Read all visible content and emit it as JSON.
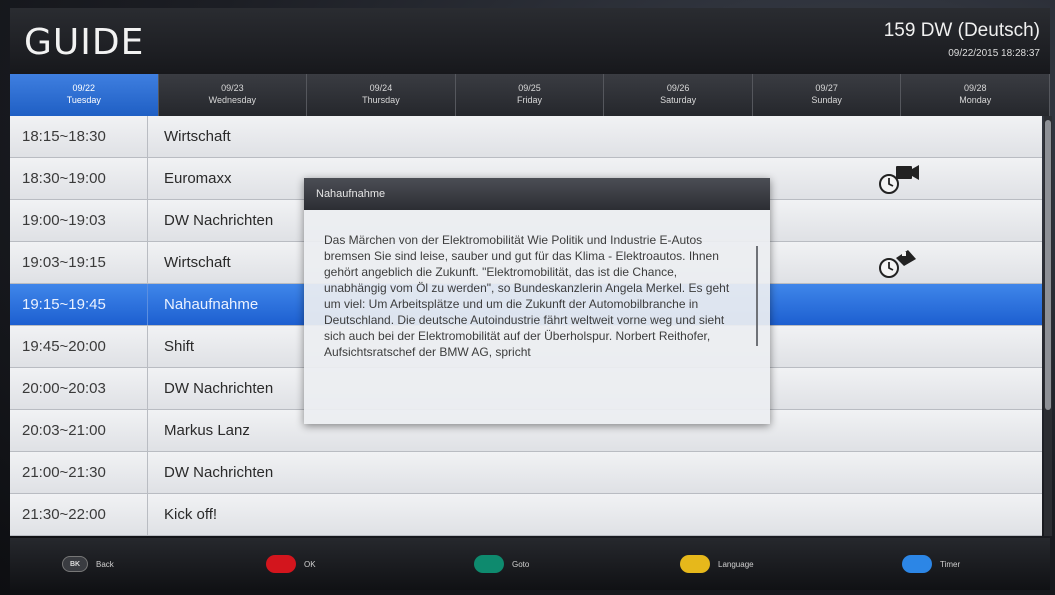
{
  "header": {
    "title": "GUIDE",
    "channel": "159 DW (Deutsch)",
    "datetime": "09/22/2015 18:28:37"
  },
  "tabs": [
    {
      "date": "09/22",
      "day": "Tuesday",
      "active": true
    },
    {
      "date": "09/23",
      "day": "Wednesday",
      "active": false
    },
    {
      "date": "09/24",
      "day": "Thursday",
      "active": false
    },
    {
      "date": "09/25",
      "day": "Friday",
      "active": false
    },
    {
      "date": "09/26",
      "day": "Saturday",
      "active": false
    },
    {
      "date": "09/27",
      "day": "Sunday",
      "active": false
    },
    {
      "date": "09/28",
      "day": "Monday",
      "active": false
    }
  ],
  "schedule": [
    {
      "time": "18:15~18:30",
      "title": "Wirtschaft"
    },
    {
      "time": "18:30~19:00",
      "title": "Euromaxx",
      "icon": "record-timer-icon"
    },
    {
      "time": "19:00~19:03",
      "title": "DW Nachrichten"
    },
    {
      "time": "19:03~19:15",
      "title": "Wirtschaft",
      "icon": "reminder-timer-icon"
    },
    {
      "time": "19:15~19:45",
      "title": "Nahaufnahme",
      "selected": true
    },
    {
      "time": "19:45~20:00",
      "title": "Shift"
    },
    {
      "time": "20:00~20:03",
      "title": "DW Nachrichten"
    },
    {
      "time": "20:03~21:00",
      "title": "Markus Lanz"
    },
    {
      "time": "21:00~21:30",
      "title": "DW Nachrichten"
    },
    {
      "time": "21:30~22:00",
      "title": "Kick off!"
    }
  ],
  "popup": {
    "title": "Nahaufnahme",
    "description": "Das Märchen von der Elektromobilität Wie Politik und Industrie E-Autos bremsen Sie sind leise, sauber und gut für das Klima - Elektroautos. Ihnen gehört angeblich die Zukunft. \"Elektromobilität, das ist die Chance, unabhängig vom Öl zu werden\", so Bundeskanzlerin Angela Merkel. Es geht um viel: Um Arbeitsplätze und um die Zukunft der Automobilbranche in Deutschland. Die deutsche Autoindustrie fährt weltweit vorne weg und sieht sich auch bei der Elektromobilität auf der Überholspur. Norbert Reithofer, Aufsichtsratschef der BMW AG, spricht"
  },
  "footer": {
    "back_key": "BK",
    "back_label": "Back",
    "red_label": "OK",
    "green_label": "Goto",
    "yellow_label": "Language",
    "blue_label": "Timer"
  },
  "colors": {
    "red_key": "#d3151d",
    "green_key": "#0e8a6e",
    "yellow_key": "#e6b81b",
    "blue_key": "#2c86e6",
    "accent": "#2a6fdc"
  }
}
